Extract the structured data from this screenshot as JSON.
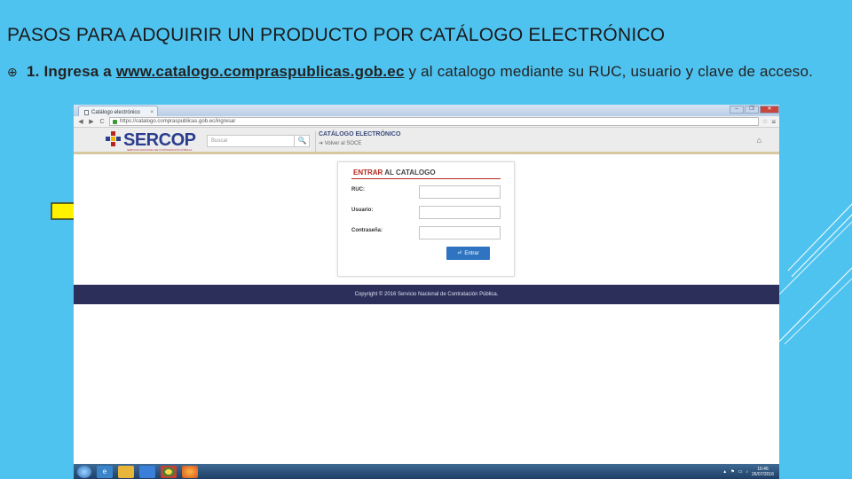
{
  "slide": {
    "title": "PASOS PARA ADQUIRIR UN PRODUCTO POR CATÁLOGO ELECTRÓNICO",
    "bullet_glyph": "⊕",
    "step_prefix": "1. Ingresa a ",
    "step_link": "www.catalogo.compraspublicas.gob.ec",
    "step_suffix": " y al catalogo mediante su RUC, usuario y clave de acceso.",
    "arrow_color": "#fff200",
    "background_color": "#4fc3f0"
  },
  "browser": {
    "tab_title": "Catálogo electrónico",
    "tab_close": "×",
    "url": "https://catalogo.compraspublicas.gob.ec/ingresar",
    "window_buttons": [
      "–",
      "❐",
      "✕"
    ],
    "back": "◀",
    "forward": "▶",
    "reload": "C",
    "star": "☆",
    "menu": "≡"
  },
  "site": {
    "logo_text": "SERCOP",
    "logo_sub": "SERVICIO NACIONAL DE CONTRATACIÓN PÚBLICA",
    "search_placeholder": "Buscar",
    "search_icon": "🔍",
    "catalog_title": "CATÁLOGO ELECTRÓNICO",
    "back_link": "➔ Volver al SOCE",
    "home_icon": "⌂",
    "brand_color": "#2b3d8f"
  },
  "login": {
    "heading_red": "ENTRAR",
    "heading_dark": " AL CATALOGO",
    "fields": [
      {
        "label": "RUC:"
      },
      {
        "label": "Usuario:"
      },
      {
        "label": "Contraseña:"
      }
    ],
    "button_icon": "⏎",
    "button_label": "Entrar",
    "accent_color": "#b6261e",
    "button_color": "#2f74c0"
  },
  "footer": {
    "text": "Copyright © 2016 Servicio Nacional de Contratación Pública."
  },
  "taskbar": {
    "clock_time": "16:46",
    "clock_date": "26/07/2016",
    "tray_icons": [
      "▲",
      "⚑",
      "▭",
      "♪"
    ]
  }
}
